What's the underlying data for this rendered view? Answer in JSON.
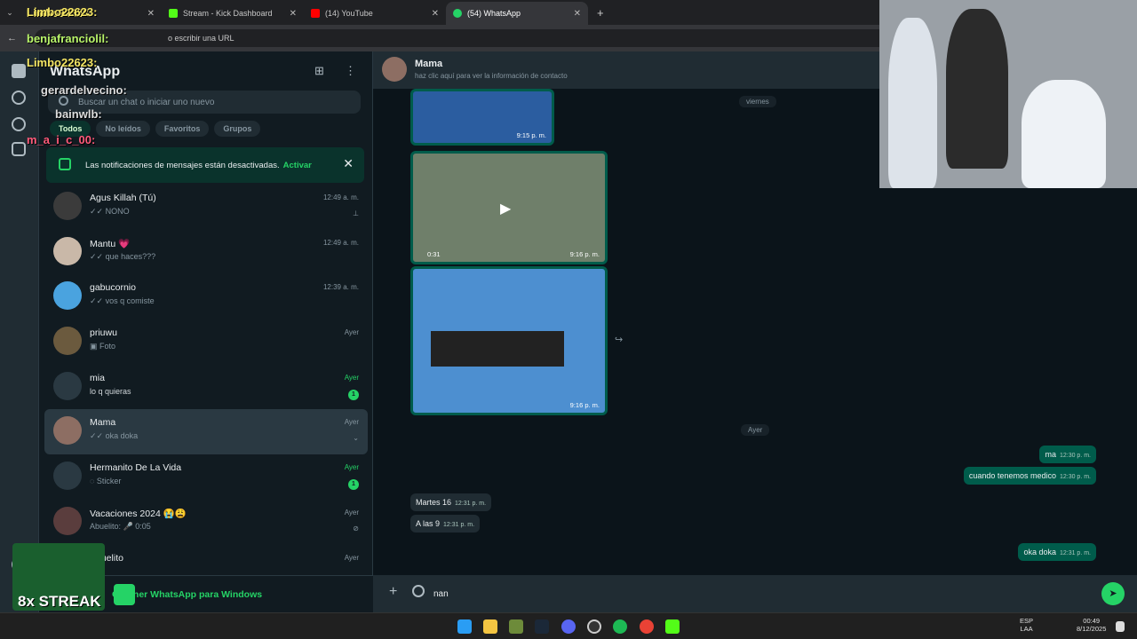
{
  "browser": {
    "tabs": [
      {
        "label": "Limbo22623:"
      },
      {
        "label": "Stream - Kick Dashboard"
      },
      {
        "label": "(14) YouTube"
      },
      {
        "label": "(54) WhatsApp"
      }
    ],
    "url_placeholder": "o escribir una URL"
  },
  "sidebar": {
    "title": "WhatsApp",
    "search_placeholder": "Buscar un chat o iniciar uno nuevo",
    "filters": [
      "Todos",
      "No leídos",
      "Favoritos",
      "Grupos"
    ],
    "notification": {
      "text": "Las notificaciones de mensajes están desactivadas.",
      "action": "Activar"
    },
    "chats": [
      {
        "name": "Agus Killah (Tú)",
        "msg": "✓✓ NONO",
        "time": "12:49 a. m."
      },
      {
        "name": "Mantu 💗",
        "msg": "✓✓ que haces???",
        "time": "12:49 a. m."
      },
      {
        "name": "gabucornio",
        "msg": "✓✓ vos q comiste",
        "time": "12:39 a. m."
      },
      {
        "name": "priuwu",
        "msg": "▣ Foto",
        "time": "Ayer"
      },
      {
        "name": "mia",
        "msg": "lo q quieras",
        "time": "Ayer",
        "unread": "1"
      },
      {
        "name": "Mama",
        "msg": "✓✓ oka doka",
        "time": "Ayer"
      },
      {
        "name": "Hermanito De La Vida",
        "msg": "◌ Sticker",
        "time": "Ayer",
        "unread": "1"
      },
      {
        "name": "Vacaciones 2024 😭😩",
        "msg": "Abuelito: 🎤 0:05",
        "time": "Ayer"
      },
      {
        "name": "Abuelito",
        "msg": "",
        "time": "Ayer"
      }
    ],
    "get_app": "Obtener WhatsApp para Windows"
  },
  "chat": {
    "contact": "Mama",
    "subtitle": "haz clic aquí para ver la información de contacto",
    "day_friday": "viernes",
    "day_yesterday": "Ayer",
    "media": [
      {
        "time": "9:15 p. m."
      },
      {
        "time": "9:16 p. m.",
        "duration": "0:31"
      },
      {
        "time": "9:16 p. m."
      }
    ],
    "messages": [
      {
        "text": "ma",
        "time": "12:30 p. m.",
        "dir": "out"
      },
      {
        "text": "cuando tenemos medico",
        "time": "12:30 p. m.",
        "dir": "out"
      },
      {
        "text": "Martes 16",
        "time": "12:31 p. m.",
        "dir": "in"
      },
      {
        "text": "A las 9",
        "time": "12:31 p. m.",
        "dir": "in"
      },
      {
        "text": "oka doka",
        "time": "12:31 p. m.",
        "dir": "out"
      }
    ],
    "draft": "nan"
  },
  "overlay": {
    "users": [
      "Limbo22623:",
      "benjafranciolil:",
      "Limbo22623:",
      "gerardelvecino:",
      "bainwlb:",
      "m_a_i_c_00:"
    ],
    "streak": "8x STREAK"
  },
  "taskbar": {
    "lang": "ESP",
    "lang2": "LAA",
    "time": "00:49",
    "date": "8/12/2025"
  },
  "colors": {
    "accent": "#25d366",
    "outgoing": "#005c4b",
    "panel": "#202c33"
  }
}
